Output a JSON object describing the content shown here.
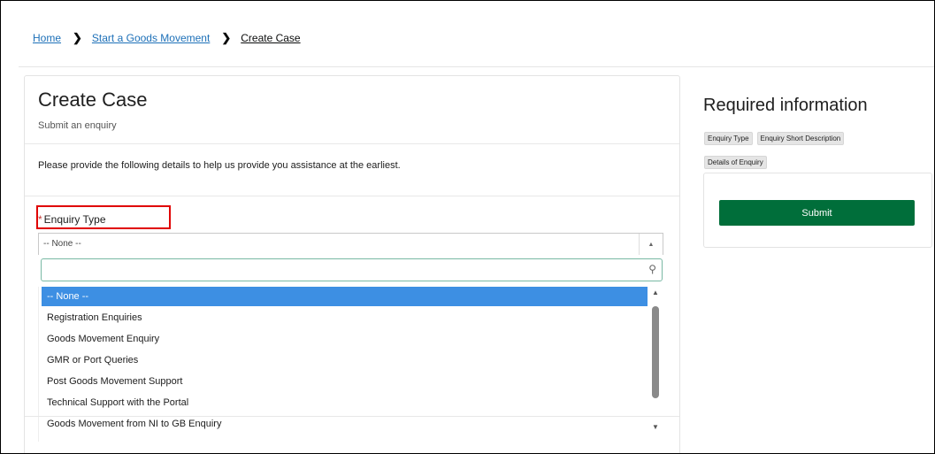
{
  "breadcrumb": {
    "home": "Home",
    "goods_movement": "Start a Goods Movement",
    "current": "Create Case"
  },
  "form": {
    "title": "Create Case",
    "subtitle": "Submit an enquiry",
    "intro": "Please provide the following details to help us provide you assistance at the earliest.",
    "required_marker": "*",
    "field_label": "Enquiry Type",
    "selected_value": "-- None --",
    "search_value": "",
    "options": [
      "-- None --",
      "Registration Enquiries",
      "Goods Movement Enquiry",
      "GMR or Port Queries",
      "Post Goods Movement Support",
      "Technical Support with the Portal",
      "Goods Movement from NI to GB Enquiry"
    ],
    "highlighted_option": "-- None --"
  },
  "sidebar": {
    "title": "Required information",
    "tags": [
      "Enquiry Type",
      "Enquiry Short Description",
      "Details of Enquiry"
    ],
    "submit_label": "Submit"
  },
  "icons": {
    "breadcrumb_separator": "chevron-right-icon",
    "dropdown_arrow": "caret-up-icon",
    "search": "search-icon",
    "scroll_up": "scroll-up-icon",
    "scroll_down": "scroll-down-icon"
  },
  "colors": {
    "link": "#1d70b8",
    "submit_bg": "#006e3a",
    "highlight_bg": "#3d8fe3",
    "annotation_box": "#e00000",
    "required_marker": "#c23934"
  }
}
